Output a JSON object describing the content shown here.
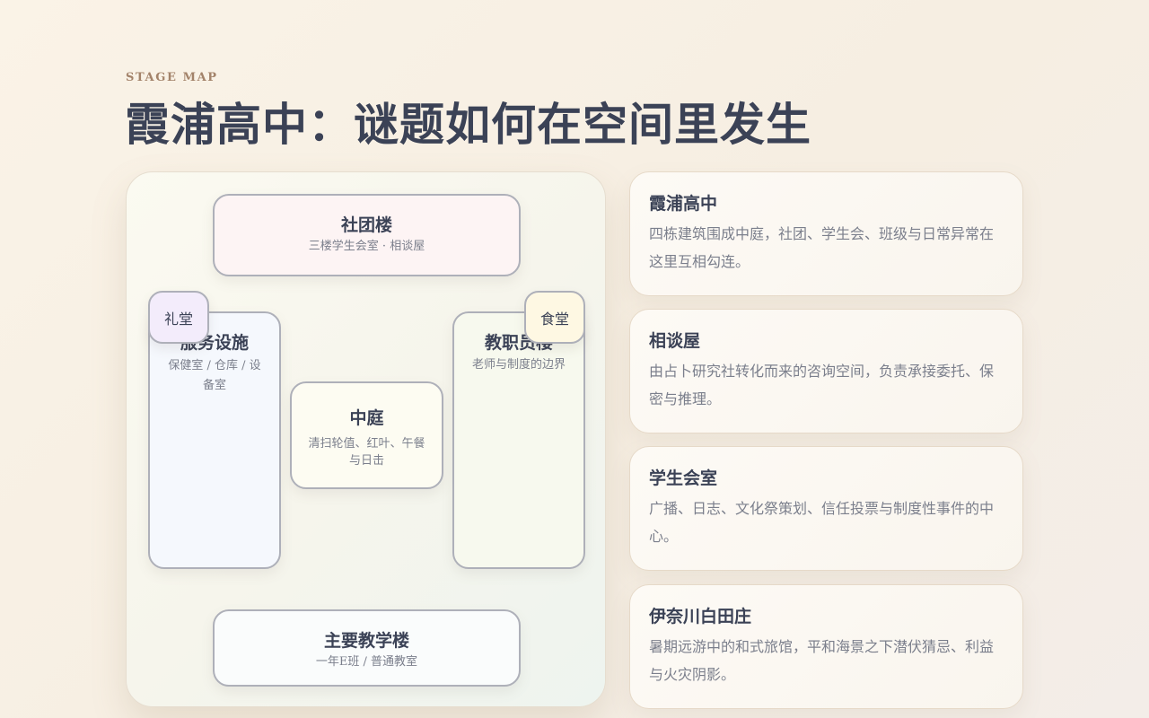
{
  "header": {
    "eyebrow": "STAGE MAP",
    "title": "霞浦高中：谜题如何在空间里发生"
  },
  "map": {
    "club_building": {
      "name": "社团楼",
      "sub": "三楼学生会室 · 相谈屋"
    },
    "service": {
      "name": "服务设施",
      "sub": "保健室 / 仓库 / 设备室"
    },
    "staff_building": {
      "name": "教职员楼",
      "sub": "老师与制度的边界"
    },
    "courtyard": {
      "name": "中庭",
      "sub": "清扫轮值、红叶、午餐与日击"
    },
    "main_building": {
      "name": "主要教学楼",
      "sub": "一年E班 / 普通教室"
    },
    "hall": {
      "name": "礼堂"
    },
    "canteen": {
      "name": "食堂"
    }
  },
  "cards": [
    {
      "title": "霞浦高中",
      "body": "四栋建筑围成中庭，社团、学生会、班级与日常异常在这里互相勾连。"
    },
    {
      "title": "相谈屋",
      "body": "由占卜研究社转化而来的咨询空间，负责承接委托、保密与推理。"
    },
    {
      "title": "学生会室",
      "body": "广播、日志、文化祭策划、信任投票与制度性事件的中心。"
    },
    {
      "title": "伊奈川白田庄",
      "body": "暑期远游中的和式旅馆，平和海景之下潜伏猜忌、利益与火灾阴影。"
    }
  ]
}
